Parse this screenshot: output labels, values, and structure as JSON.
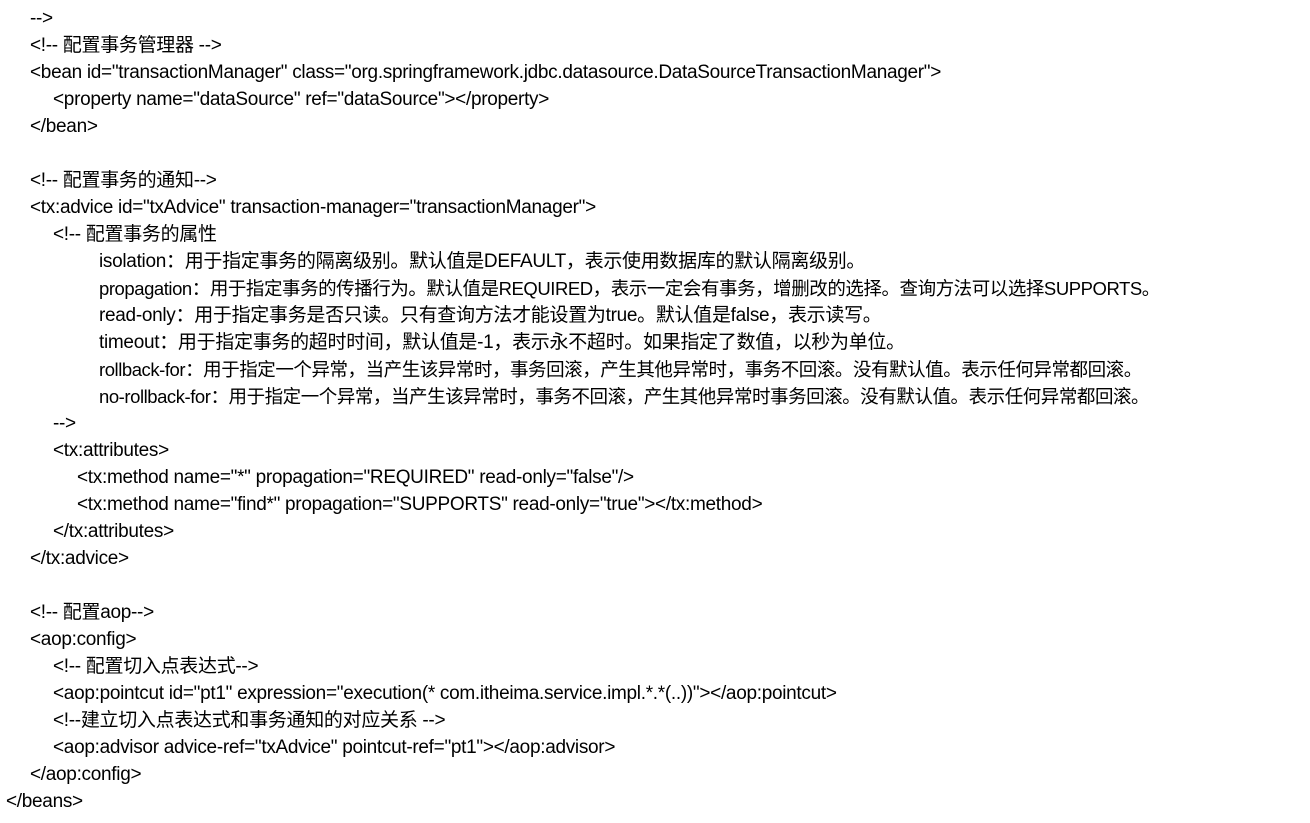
{
  "document": {
    "lines": [
      "-->",
      "<!-- 配置事务管理器 -->",
      "<bean id=\"transactionManager\" class=\"org.springframework.jdbc.datasource.DataSourceTransactionManager\">",
      "<property name=\"dataSource\" ref=\"dataSource\"></property>",
      "</bean>",
      "",
      "<!-- 配置事务的通知-->",
      "<tx:advice id=\"txAdvice\" transaction-manager=\"transactionManager\">",
      "<!-- 配置事务的属性",
      "isolation：用于指定事务的隔离级别。默认值是DEFAULT，表示使用数据库的默认隔离级别。",
      "propagation：用于指定事务的传播行为。默认值是REQUIRED，表示一定会有事务，增删改的选择。查询方法可以选择SUPPORTS。",
      "read-only：用于指定事务是否只读。只有查询方法才能设置为true。默认值是false，表示读写。",
      "timeout：用于指定事务的超时时间，默认值是-1，表示永不超时。如果指定了数值，以秒为单位。",
      "rollback-for：用于指定一个异常，当产生该异常时，事务回滚，产生其他异常时，事务不回滚。没有默认值。表示任何异常都回滚。",
      "no-rollback-for：用于指定一个异常，当产生该异常时，事务不回滚，产生其他异常时事务回滚。没有默认值。表示任何异常都回滚。",
      "-->",
      "<tx:attributes>",
      "<tx:method name=\"*\" propagation=\"REQUIRED\" read-only=\"false\"/>",
      "<tx:method name=\"find*\" propagation=\"SUPPORTS\" read-only=\"true\"></tx:method>",
      "</tx:attributes>",
      "</tx:advice>",
      "",
      "<!-- 配置aop-->",
      "<aop:config>",
      "<!-- 配置切入点表达式-->",
      "<aop:pointcut id=\"pt1\" expression=\"execution(* com.itheima.service.impl.*.*(..))\"></aop:pointcut>",
      "<!--建立切入点表达式和事务通知的对应关系 -->",
      "<aop:advisor advice-ref=\"txAdvice\" pointcut-ref=\"pt1\"></aop:advisor>",
      "</aop:config>",
      "</beans>"
    ]
  }
}
